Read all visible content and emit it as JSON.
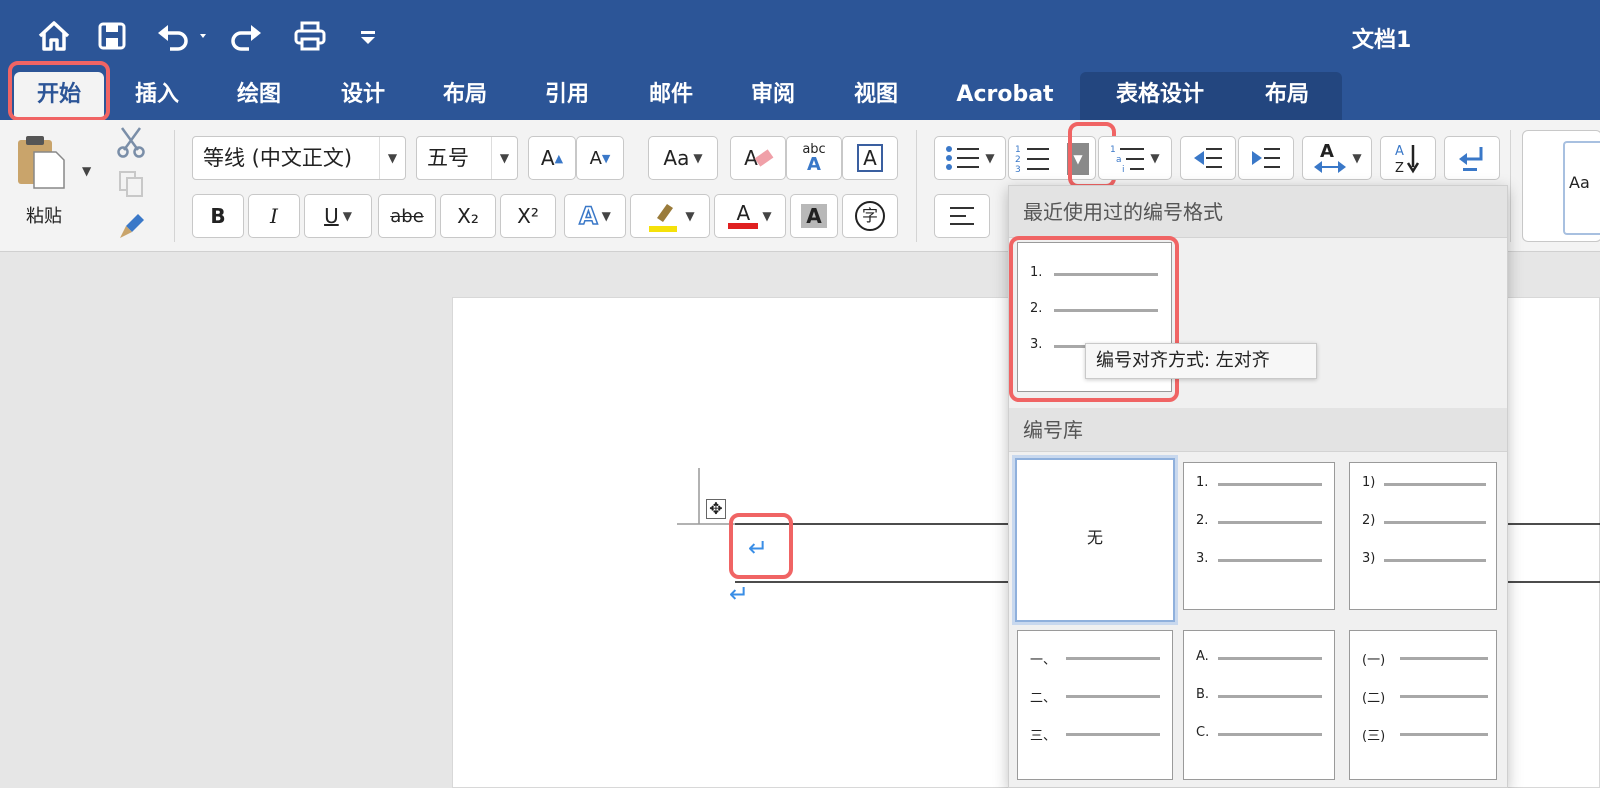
{
  "window": {
    "title": "文档1"
  },
  "tabs": [
    "开始",
    "插入",
    "绘图",
    "设计",
    "布局",
    "引用",
    "邮件",
    "审阅",
    "视图",
    "Acrobat",
    "表格设计",
    "布局"
  ],
  "clipboard": {
    "paste_label": "粘贴"
  },
  "font": {
    "family": "等线 (中文正文)",
    "size": "五号"
  },
  "ribbon": {
    "grow": "A",
    "shrink": "A",
    "change_case": "Aa",
    "clear": "A",
    "phonetic_top": "abc",
    "phonetic_letter": "A",
    "border_char": "A",
    "bold": "B",
    "italic": "I",
    "underline": "U",
    "strike": "abe",
    "subscript": "X₂",
    "superscript": "X²",
    "effects": "A",
    "font_color": "A",
    "shading": "A",
    "enclose": "字",
    "sort": "A↓Z",
    "styles_preview": "Aa"
  },
  "numbering_panel": {
    "recent_header": "最近使用过的编号格式",
    "library_header": "编号库",
    "recent": {
      "items": [
        "1.",
        "2.",
        "3."
      ]
    },
    "tooltip": "编号对齐方式: 左对齐",
    "library": [
      {
        "label": "无",
        "items": []
      },
      {
        "items": [
          "1.",
          "2.",
          "3."
        ]
      },
      {
        "items": [
          "1)",
          "2)",
          "3)"
        ]
      },
      {
        "items": [
          "一、",
          "二、",
          "三、"
        ]
      },
      {
        "items": [
          "A.",
          "B.",
          "C."
        ]
      },
      {
        "items": [
          "(一)",
          "(二)",
          "(三)"
        ]
      }
    ]
  },
  "colors": {
    "brand": "#2c5597",
    "highlight": "#f06464",
    "font_color": "#e02020",
    "marker": "#f5e10a"
  }
}
